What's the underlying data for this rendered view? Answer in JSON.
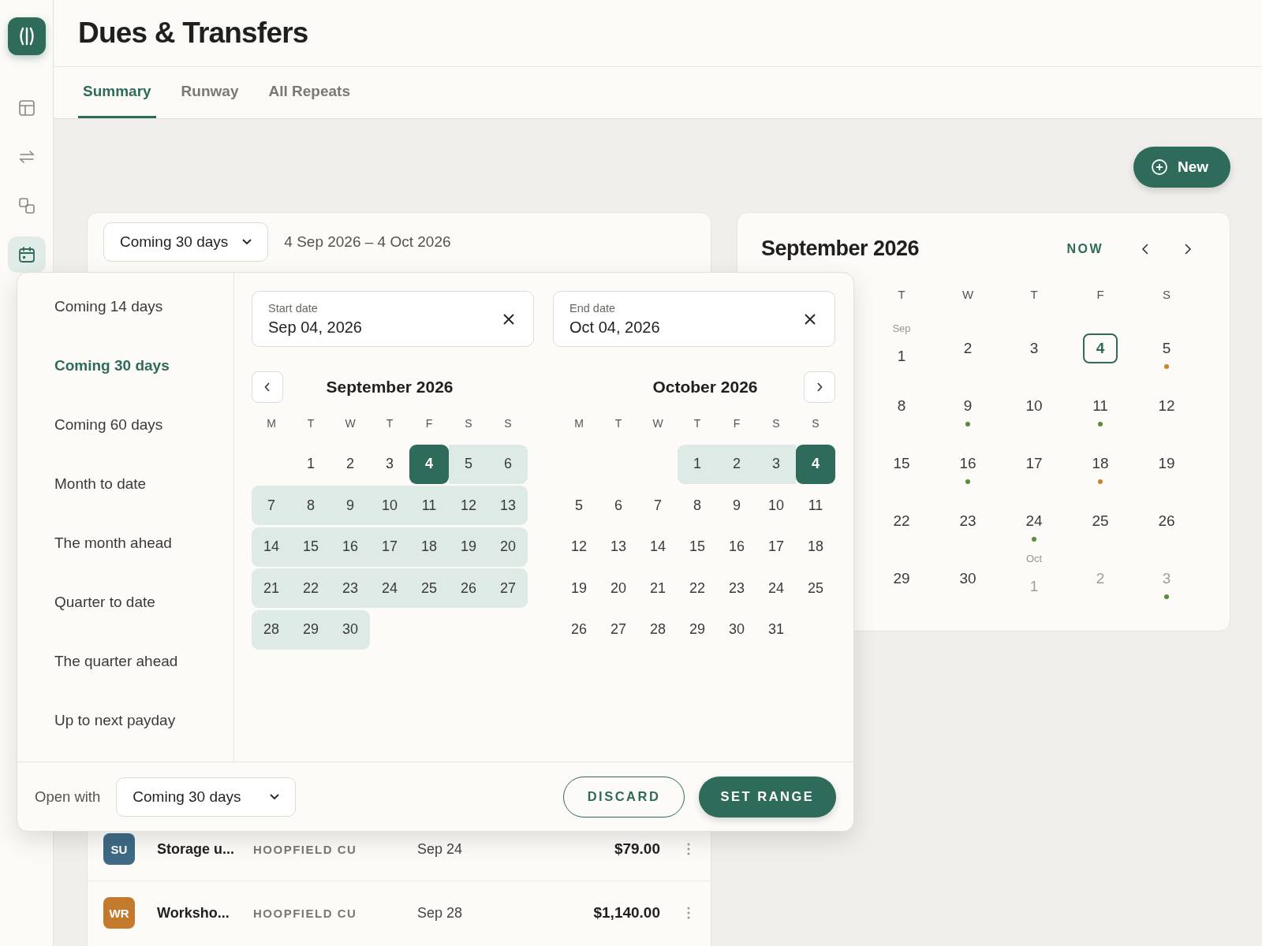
{
  "app": {
    "title": "Dues & Transfers"
  },
  "sidebar": {
    "items": [
      {
        "kind": "layout",
        "selected": false
      },
      {
        "kind": "transfers",
        "selected": false
      },
      {
        "kind": "shapes",
        "selected": false
      },
      {
        "kind": "calendar",
        "selected": true
      }
    ]
  },
  "tabs": [
    {
      "label": "Summary",
      "selected": true
    },
    {
      "label": "Runway",
      "selected": false
    },
    {
      "label": "All Repeats",
      "selected": false
    }
  ],
  "new_button": {
    "label": "New"
  },
  "range_bar": {
    "dropdown": "Coming 30 days",
    "range_text": "4 Sep 2026 – 4 Oct 2026"
  },
  "rows": [
    {
      "initials": "SU",
      "color": "#3e6a85",
      "name": "Storage u...",
      "account": "HOOPFIELD CU",
      "date": "Sep 24",
      "amount": "$79.00"
    },
    {
      "initials": "WR",
      "color": "#c47a2c",
      "name": "Worksho...",
      "account": "HOOPFIELD CU",
      "date": "Sep 28",
      "amount": "$1,140.00"
    }
  ],
  "month_card": {
    "title": "September 2026",
    "now_label": "NOW",
    "weekdays": [
      "T",
      "W",
      "T",
      "F",
      "S"
    ],
    "weeks": [
      [
        {
          "day": "1",
          "month_label": "Sep",
          "muted": false,
          "today": false
        },
        {
          "day": "2",
          "muted": false,
          "today": false
        },
        {
          "day": "3",
          "muted": false,
          "today": false
        },
        {
          "day": "4",
          "muted": false,
          "today": true
        },
        {
          "day": "5",
          "muted": false,
          "today": false,
          "color": "#c8842f"
        }
      ],
      [
        {
          "day": "8",
          "muted": false,
          "today": false
        },
        {
          "day": "9",
          "muted": false,
          "today": false,
          "color": "#5b8c3e"
        },
        {
          "day": "10",
          "muted": false,
          "today": false
        },
        {
          "day": "11",
          "muted": false,
          "today": false,
          "color": "#5b8c3e"
        },
        {
          "day": "12",
          "muted": false,
          "today": false
        }
      ],
      [
        {
          "day": "15",
          "muted": false,
          "today": false
        },
        {
          "day": "16",
          "muted": false,
          "today": false,
          "color": "#5b8c3e"
        },
        {
          "day": "17",
          "muted": false,
          "today": false
        },
        {
          "day": "18",
          "muted": false,
          "today": false,
          "color": "#c8842f"
        },
        {
          "day": "19",
          "muted": false,
          "today": false
        }
      ],
      [
        {
          "day": "22",
          "muted": false,
          "today": false
        },
        {
          "day": "23",
          "muted": false,
          "today": false
        },
        {
          "day": "24",
          "muted": false,
          "today": false,
          "color": "#5b8c3e"
        },
        {
          "day": "25",
          "muted": false,
          "today": false
        },
        {
          "day": "26",
          "muted": false,
          "today": false
        }
      ],
      [
        {
          "day": "29",
          "muted": false,
          "today": false
        },
        {
          "day": "30",
          "muted": false,
          "today": false
        },
        {
          "day": "1",
          "month_label": "Oct",
          "muted": true,
          "today": false
        },
        {
          "day": "2",
          "muted": true,
          "today": false
        },
        {
          "day": "3",
          "muted": true,
          "today": false,
          "color": "#5b8c3e"
        }
      ]
    ]
  },
  "picker": {
    "presets": [
      {
        "label": "Coming 14 days",
        "selected": false
      },
      {
        "label": "Coming 30 days",
        "selected": true
      },
      {
        "label": "Coming 60 days",
        "selected": false
      },
      {
        "label": "Month to date",
        "selected": false
      },
      {
        "label": "The month ahead",
        "selected": false
      },
      {
        "label": "Quarter to date",
        "selected": false
      },
      {
        "label": "The quarter ahead",
        "selected": false
      },
      {
        "label": "Up to next payday",
        "selected": false
      }
    ],
    "start": {
      "label": "Start date",
      "value": "Sep 04, 2026"
    },
    "end": {
      "label": "End date",
      "value": "Oct 04, 2026"
    },
    "months": [
      {
        "title": "September 2026",
        "weekdays": [
          "M",
          "T",
          "W",
          "T",
          "F",
          "S",
          "S"
        ],
        "weeks": [
          [
            {
              "day": "1",
              "in_range": false,
              "selected": false
            },
            {
              "day": "2",
              "in_range": false,
              "selected": false
            },
            {
              "day": "3",
              "in_range": false,
              "selected": false
            },
            {
              "day": "4",
              "in_range": false,
              "selected": true
            },
            {
              "day": "5",
              "in_range": true,
              "selected": false
            },
            {
              "day": "6",
              "in_range": true,
              "selected": false
            }
          ],
          [
            {
              "day": "7",
              "in_range": true,
              "selected": false
            },
            {
              "day": "8",
              "in_range": true,
              "selected": false
            },
            {
              "day": "9",
              "in_range": true,
              "selected": false
            },
            {
              "day": "10",
              "in_range": true,
              "selected": false
            },
            {
              "day": "11",
              "in_range": true,
              "selected": false
            },
            {
              "day": "12",
              "in_range": true,
              "selected": false
            },
            {
              "day": "13",
              "in_range": true,
              "selected": false
            }
          ],
          [
            {
              "day": "14",
              "in_range": true,
              "selected": false
            },
            {
              "day": "15",
              "in_range": true,
              "selected": false
            },
            {
              "day": "16",
              "in_range": true,
              "selected": false
            },
            {
              "day": "17",
              "in_range": true,
              "selected": false
            },
            {
              "day": "18",
              "in_range": true,
              "selected": false
            },
            {
              "day": "19",
              "in_range": true,
              "selected": false
            },
            {
              "day": "20",
              "in_range": true,
              "selected": false
            }
          ],
          [
            {
              "day": "21",
              "in_range": true,
              "selected": false
            },
            {
              "day": "22",
              "in_range": true,
              "selected": false
            },
            {
              "day": "23",
              "in_range": true,
              "selected": false
            },
            {
              "day": "24",
              "in_range": true,
              "selected": false
            },
            {
              "day": "25",
              "in_range": true,
              "selected": false
            },
            {
              "day": "26",
              "in_range": true,
              "selected": false
            },
            {
              "day": "27",
              "in_range": true,
              "selected": false
            }
          ],
          [
            {
              "day": "28",
              "in_range": true,
              "selected": false
            },
            {
              "day": "29",
              "in_range": true,
              "selected": false
            },
            {
              "day": "30",
              "in_range": true,
              "selected": false
            }
          ]
        ]
      },
      {
        "title": "October 2026",
        "weekdays": [
          "M",
          "T",
          "W",
          "T",
          "F",
          "S",
          "S"
        ],
        "weeks": [
          [
            {
              "day": "1",
              "in_range": true,
              "selected": false
            },
            {
              "day": "2",
              "in_range": true,
              "selected": false
            },
            {
              "day": "3",
              "in_range": true,
              "selected": false
            },
            {
              "day": "4",
              "in_range": false,
              "selected": true
            }
          ],
          [
            {
              "day": "5",
              "in_range": false,
              "selected": false
            },
            {
              "day": "6",
              "in_range": false,
              "selected": false
            },
            {
              "day": "7",
              "in_range": false,
              "selected": false
            },
            {
              "day": "8",
              "in_range": false,
              "selected": false
            },
            {
              "day": "9",
              "in_range": false,
              "selected": false
            },
            {
              "day": "10",
              "in_range": false,
              "selected": false
            },
            {
              "day": "11",
              "in_range": false,
              "selected": false
            }
          ],
          [
            {
              "day": "12",
              "in_range": false,
              "selected": false
            },
            {
              "day": "13",
              "in_range": false,
              "selected": false
            },
            {
              "day": "14",
              "in_range": false,
              "selected": false
            },
            {
              "day": "15",
              "in_range": false,
              "selected": false
            },
            {
              "day": "16",
              "in_range": false,
              "selected": false
            },
            {
              "day": "17",
              "in_range": false,
              "selected": false
            },
            {
              "day": "18",
              "in_range": false,
              "selected": false
            }
          ],
          [
            {
              "day": "19",
              "in_range": false,
              "selected": false
            },
            {
              "day": "20",
              "in_range": false,
              "selected": false
            },
            {
              "day": "21",
              "in_range": false,
              "selected": false
            },
            {
              "day": "22",
              "in_range": false,
              "selected": false
            },
            {
              "day": "23",
              "in_range": false,
              "selected": false
            },
            {
              "day": "24",
              "in_range": false,
              "selected": false
            },
            {
              "day": "25",
              "in_range": false,
              "selected": false
            }
          ],
          [
            {
              "day": "26",
              "in_range": false,
              "selected": false
            },
            {
              "day": "27",
              "in_range": false,
              "selected": false
            },
            {
              "day": "28",
              "in_range": false,
              "selected": false
            },
            {
              "day": "29",
              "in_range": false,
              "selected": false
            },
            {
              "day": "30",
              "in_range": false,
              "selected": false
            },
            {
              "day": "31",
              "in_range": false,
              "selected": false
            }
          ]
        ]
      }
    ],
    "footer": {
      "open_with_label": "Open with",
      "open_with_value": "Coming 30 days",
      "discard": "DISCARD",
      "confirm": "SET RANGE"
    }
  }
}
